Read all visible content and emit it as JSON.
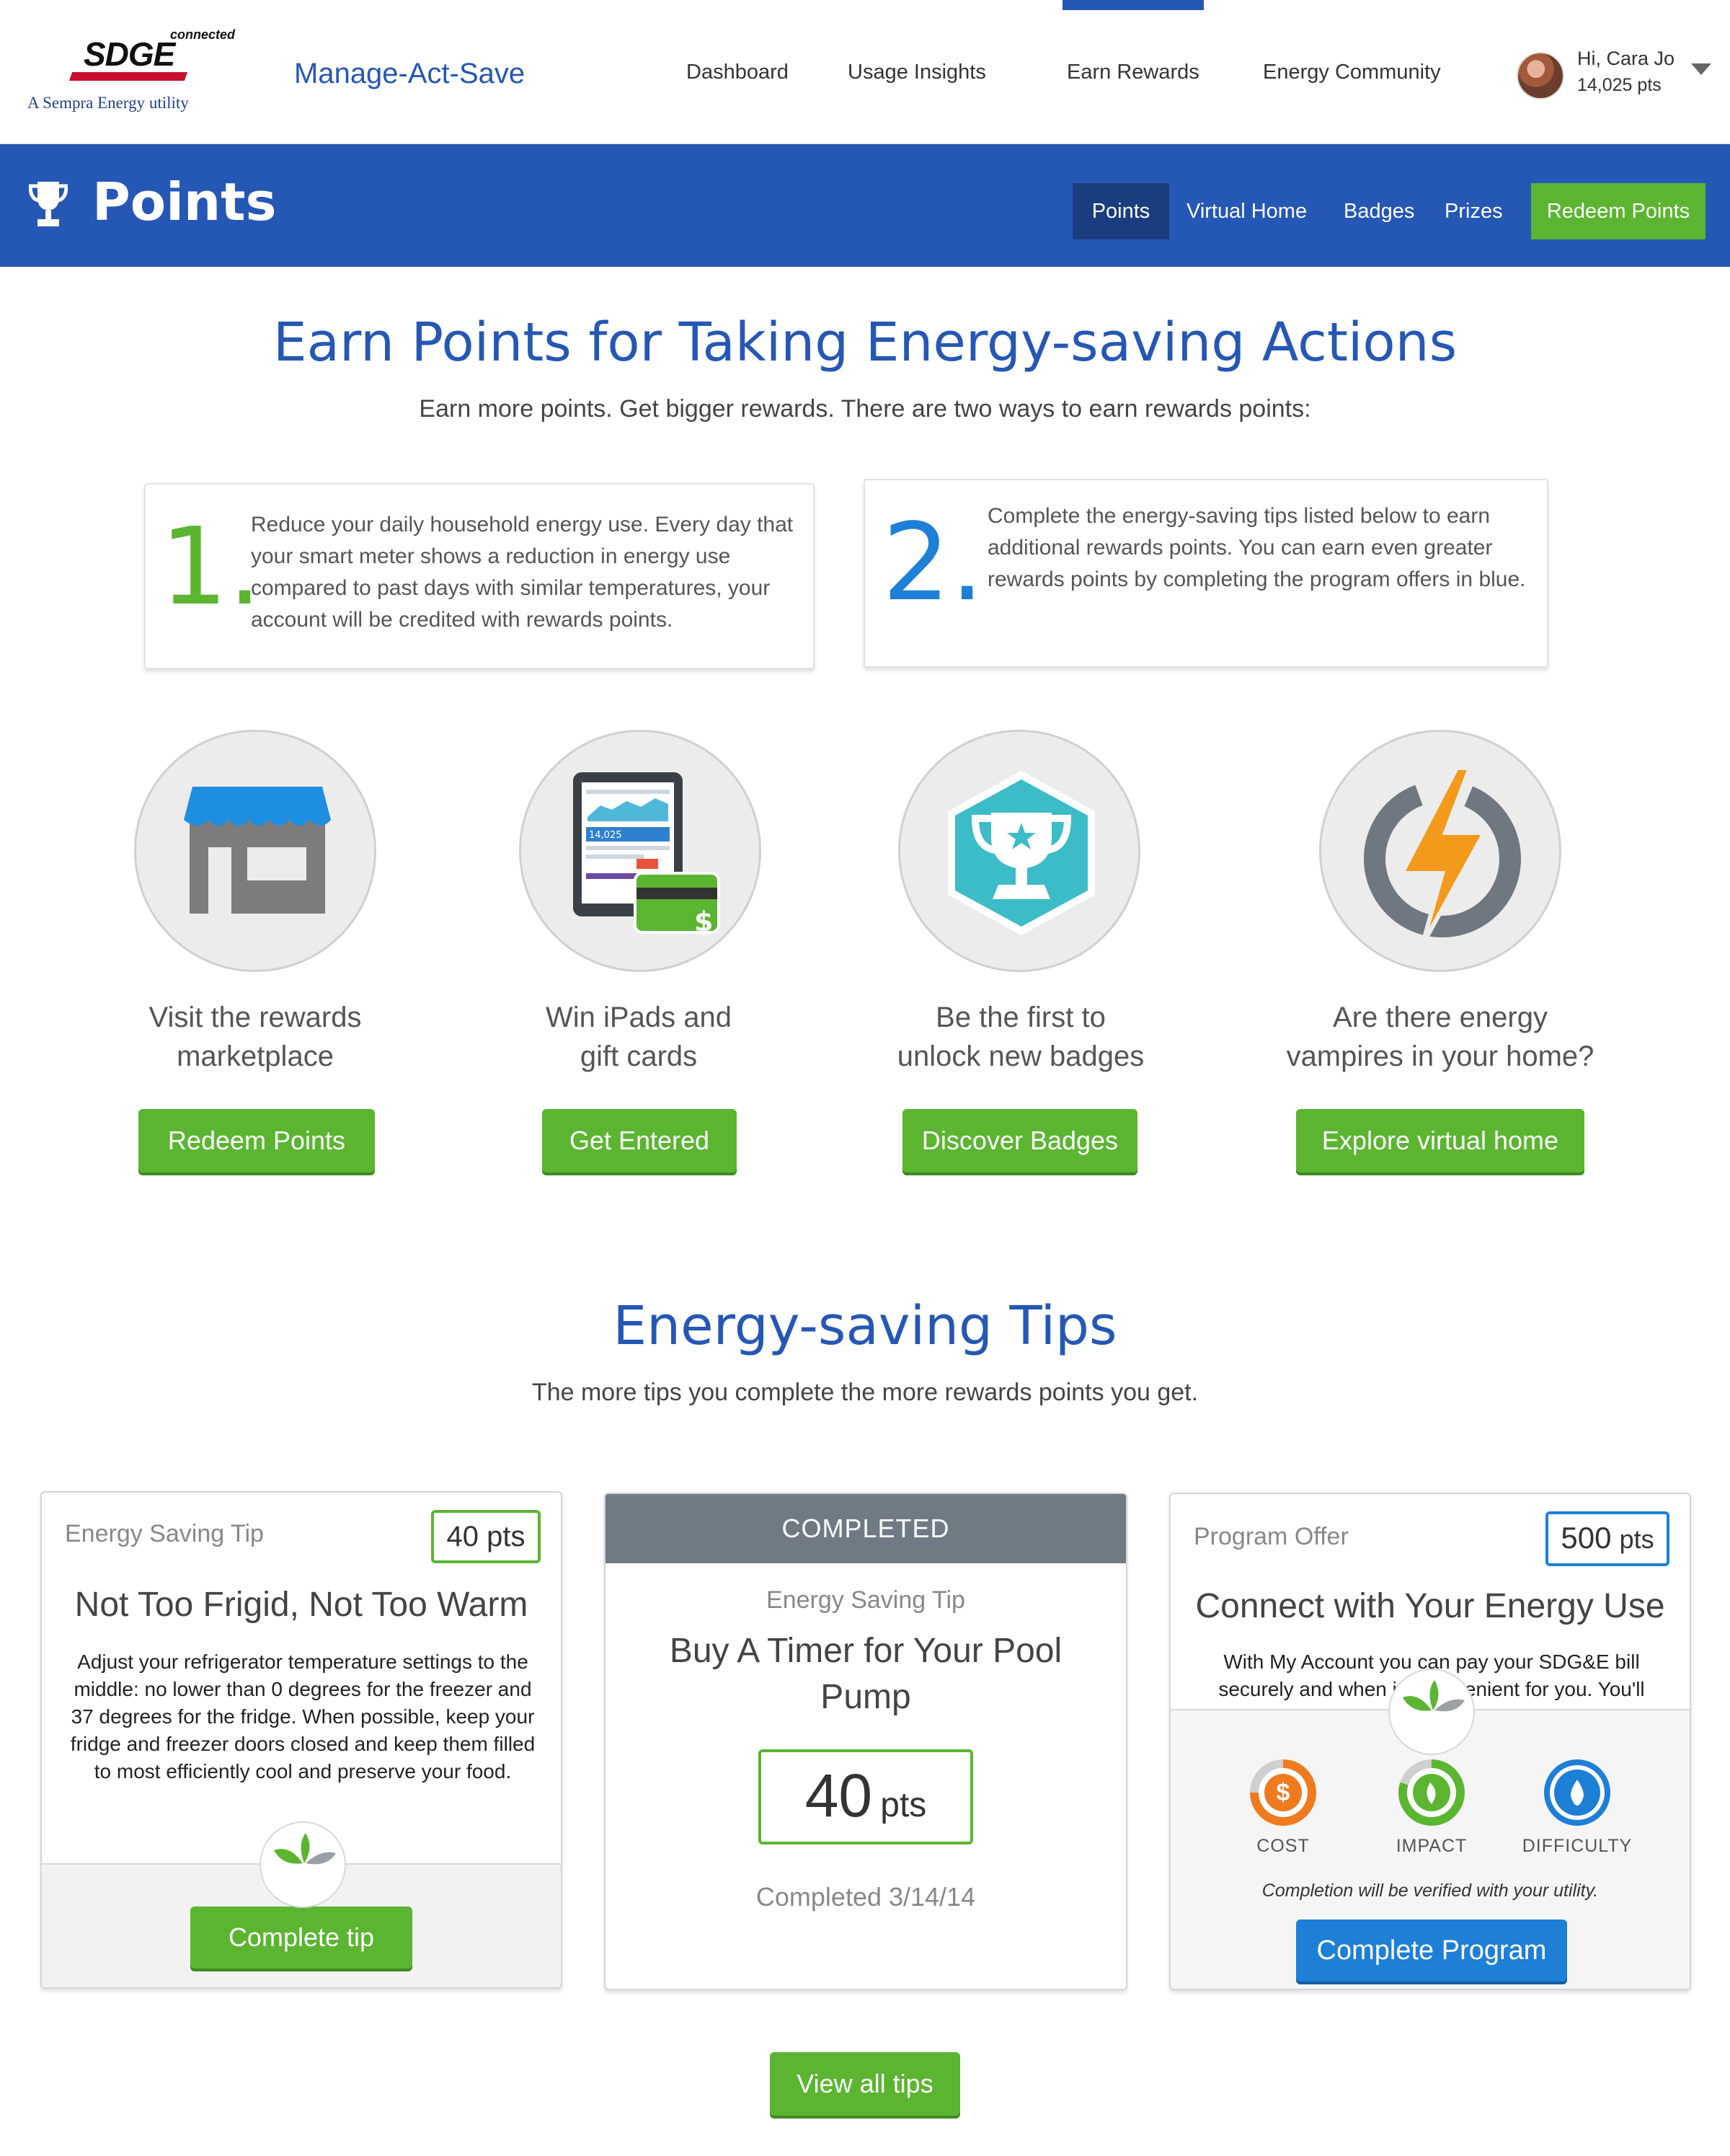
{
  "header": {
    "logo_brand": "SDGE",
    "logo_connected": "connected",
    "logo_tagline": "A Sempra Energy utility",
    "site_title": "Manage-Act-Save",
    "nav": [
      "Dashboard",
      "Usage Insights",
      "Earn Rewards",
      "Energy Community"
    ],
    "active_nav": "Earn Rewards",
    "user_greeting": "Hi, Cara Jo",
    "user_points": "14,025 pts"
  },
  "points_bar": {
    "title": "Points",
    "subnav": [
      "Points",
      "Virtual Home",
      "Badges",
      "Prizes"
    ],
    "redeem_label": "Redeem Points"
  },
  "earn": {
    "heading": "Earn Points for Taking Energy-saving Actions",
    "subheading": "Earn more points. Get bigger rewards. There are two ways to earn rewards points:",
    "ways": [
      {
        "number": "1.",
        "text": "Reduce your daily household energy use. Every day that your smart meter  shows a reduction in energy use compared to past days with similar temperatures, your account will be credited with rewards points."
      },
      {
        "number": "2.",
        "text": "Complete the energy-saving tips listed below to earn additional rewards points. You can earn even greater rewards points by completing the program offers in blue."
      }
    ]
  },
  "features": [
    {
      "label_line1": "Visit the rewards",
      "label_line2": "marketplace",
      "button": "Redeem Points",
      "icon": "storefront-icon"
    },
    {
      "label_line1": "Win iPads and",
      "label_line2": "gift cards",
      "button": "Get Entered",
      "icon": "tablet-giftcard-icon",
      "tablet_screen_value": "14,025"
    },
    {
      "label_line1": "Be the first to",
      "label_line2": "unlock new badges",
      "button": "Discover Badges",
      "icon": "trophy-badge-icon"
    },
    {
      "label_line1": "Are there energy",
      "label_line2": "vampires in your home?",
      "button": "Explore virtual home",
      "icon": "power-bolt-icon"
    }
  ],
  "tips_section": {
    "heading": "Energy-saving Tips",
    "subheading": "The more tips you complete the more rewards points you get.",
    "view_all": "View all tips"
  },
  "tips": [
    {
      "kind": "Energy Saving Tip",
      "points": "40 pts",
      "title": "Not Too Frigid, Not Too Warm",
      "description": "Adjust your refrigerator temperature settings to the middle: no lower than 0 degrees for the freezer and 37 degrees for the fridge. When possible, keep your fridge and freezer doors closed and keep them filled to most efficiently cool and preserve your food.",
      "button": "Complete tip"
    },
    {
      "status": "COMPLETED",
      "kind": "Energy Saving Tip",
      "title_line1": "Buy A Timer for Your Pool",
      "title_line2": "Pump",
      "points_value": "40",
      "points_unit": "pts",
      "completed_date": "Completed 3/14/14"
    },
    {
      "kind": "Program Offer",
      "points_value": "500",
      "points_unit": "pts",
      "title": "Connect with Your Energy Use",
      "description": "With My Account you can pay your SDG&E bill securely and when it's convenient for you. You'll also find a variety of tools to help you",
      "metrics": [
        "COST",
        "IMPACT",
        "DIFFICULTY"
      ],
      "note": "Completion will be verified with your utility.",
      "button": "Complete Program"
    }
  ],
  "colors": {
    "brand_blue": "#2557b5",
    "green": "#5bb531",
    "program_blue": "#1e7fd6",
    "completed_gray": "#6f7a85"
  }
}
